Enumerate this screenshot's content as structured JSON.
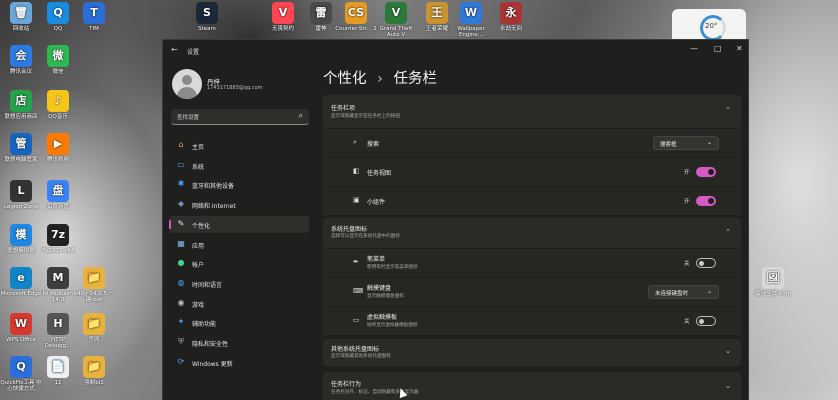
{
  "desktop": {
    "icons": [
      {
        "label": "回收站",
        "glyph": "🗑",
        "color": "#6aa6d8"
      },
      {
        "label": "QQ",
        "glyph": "Q",
        "color": "#1a8ce0"
      },
      {
        "label": "TIM",
        "glyph": "T",
        "color": "#2b6fd6"
      },
      {
        "label": "腾讯会议",
        "glyph": "会",
        "color": "#2a7be4"
      },
      {
        "label": "微信",
        "glyph": "微",
        "color": "#2dbb50"
      },
      {
        "label": "联想应用商店",
        "glyph": "店",
        "color": "#25a34a"
      },
      {
        "label": "QQ音乐",
        "glyph": "♪",
        "color": "#f5c518"
      },
      {
        "label": "联想电脑管家",
        "glyph": "管",
        "color": "#1565c0"
      },
      {
        "label": "腾讯视频",
        "glyph": "▶",
        "color": "#ff7a00"
      },
      {
        "label": "Legion Zone",
        "glyph": "L",
        "color": "#333333"
      },
      {
        "label": "百度网盘",
        "glyph": "盘",
        "color": "#3b82f6"
      },
      {
        "label": "联想模拟器",
        "glyph": "模",
        "color": "#1e88e5"
      },
      {
        "label": "7z2301-x64",
        "glyph": "7z",
        "color": "#222222"
      },
      {
        "label": "Microsoft Edge",
        "glyph": "e",
        "color": "#0f84c9"
      },
      {
        "label": "Ni Multisim 14.0",
        "glyph": "M",
        "color": "#3d3d3d"
      },
      {
        "label": "k40g 14.0.5 一键root",
        "glyph": "📁",
        "color": "#e8b23c"
      },
      {
        "label": "WPS Office",
        "glyph": "W",
        "color": "#d63a2f"
      },
      {
        "label": "HTTP Debugg...",
        "glyph": "H",
        "color": "#555555"
      },
      {
        "label": "官网",
        "glyph": "📁",
        "color": "#e8b23c"
      },
      {
        "label": "QuickFix工具 中心快捷方式",
        "glyph": "Q",
        "color": "#2a6fdb"
      },
      {
        "label": "11",
        "glyph": "📄",
        "color": "#f0f0f0"
      },
      {
        "label": "强制bl2",
        "glyph": "📁",
        "color": "#e8b23c"
      },
      {
        "label": "Steam",
        "glyph": "S",
        "color": "#1b2838"
      },
      {
        "label": "无畏契约",
        "glyph": "V",
        "color": "#ff4655"
      },
      {
        "label": "雷神",
        "glyph": "雷",
        "color": "#4a4a4a"
      },
      {
        "label": "Counter-Str... 2",
        "glyph": "CS",
        "color": "#e39b24"
      },
      {
        "label": "Grand Theft Auto V",
        "glyph": "V",
        "color": "#2b7a3a"
      },
      {
        "label": "王者荣耀",
        "glyph": "王",
        "color": "#c9932f"
      },
      {
        "label": "Wallpaper Engine...",
        "glyph": "W",
        "color": "#2f78d8"
      },
      {
        "label": "永劫无间",
        "glyph": "永",
        "color": "#a33"
      },
      {
        "label": "蜜汁圣战 vmp",
        "glyph": "🖼",
        "color": "#d8d8d8"
      }
    ]
  },
  "widget": {
    "value": "20°"
  },
  "window": {
    "app_title": "设置",
    "back": "←",
    "controls": {
      "min": "—",
      "max": "□",
      "close": "✕"
    },
    "user": {
      "name": "丹梓",
      "email": "1743171883@qq.com"
    },
    "search": {
      "placeholder": "查找设置",
      "icon": "⌕"
    },
    "nav": [
      {
        "label": "主页",
        "icon": "home-icon",
        "glyph": "⌂",
        "color": "#e9a15a",
        "active": false
      },
      {
        "label": "系统",
        "icon": "monitor-icon",
        "glyph": "▭",
        "color": "#4aa3ff",
        "active": false
      },
      {
        "label": "蓝牙和其他设备",
        "icon": "bluetooth-icon",
        "glyph": "✱",
        "color": "#4aa3ff",
        "active": false
      },
      {
        "label": "网络和 Internet",
        "icon": "wifi-icon",
        "glyph": "◈",
        "color": "#8ab4f8",
        "active": false
      },
      {
        "label": "个性化",
        "icon": "brush-icon",
        "glyph": "✎",
        "color": "#e6e6e6",
        "active": true
      },
      {
        "label": "应用",
        "icon": "apps-icon",
        "glyph": "▦",
        "color": "#8ab4f8",
        "active": false
      },
      {
        "label": "帐户",
        "icon": "account-icon",
        "glyph": "●",
        "color": "#3dd68c",
        "active": false
      },
      {
        "label": "时间和语言",
        "icon": "globe-icon",
        "glyph": "◍",
        "color": "#4aa3ff",
        "active": false
      },
      {
        "label": "游戏",
        "icon": "gamepad-icon",
        "glyph": "◉",
        "color": "#bbbbbb",
        "active": false
      },
      {
        "label": "辅助功能",
        "icon": "accessibility-icon",
        "glyph": "✦",
        "color": "#4aa3ff",
        "active": false
      },
      {
        "label": "隐私和安全性",
        "icon": "shield-icon",
        "glyph": "⛨",
        "color": "#9aa0a6",
        "active": false
      },
      {
        "label": "Windows 更新",
        "icon": "update-icon",
        "glyph": "⟳",
        "color": "#4aa3ff",
        "active": false
      }
    ],
    "breadcrumb": {
      "parent": "个性化",
      "sep": "›",
      "current": "任务栏"
    },
    "sections": {
      "taskbar_items": {
        "title": "任务栏项",
        "subtitle": "显示或隐藏显示在任务栏上的按钮",
        "rows": [
          {
            "icon": "search-icon",
            "glyph": "⌕",
            "label": "搜索",
            "dropdown": "搜索框"
          },
          {
            "icon": "taskview-icon",
            "glyph": "◧",
            "label": "任务视图",
            "state": "开"
          },
          {
            "icon": "widgets-icon",
            "glyph": "▣",
            "label": "小组件",
            "state": "开"
          }
        ]
      },
      "tray_icons": {
        "title": "系统托盘图标",
        "subtitle": "选择可以显示在系统托盘中的图标",
        "rows": [
          {
            "icon": "pen-icon",
            "glyph": "✒",
            "label": "笔菜单",
            "sub": "使用笔时显示笔菜单图标",
            "state": "关"
          },
          {
            "icon": "keyboard-icon",
            "glyph": "⌨",
            "label": "触摸键盘",
            "sub": "显示触摸键盘图标",
            "dropdown": "未连接键盘时"
          },
          {
            "icon": "touchpad-icon",
            "glyph": "▭",
            "label": "虚拟触摸板",
            "sub": "始终显示虚拟触摸板图标",
            "state": "关"
          }
        ]
      },
      "other_tray": {
        "title": "其他系统托盘图标",
        "subtitle": "显示或隐藏其他系统托盘图标"
      },
      "behaviors": {
        "title": "任务栏行为",
        "subtitle": "任务栏对齐、标记、自动隐藏和多个显示器"
      }
    }
  }
}
